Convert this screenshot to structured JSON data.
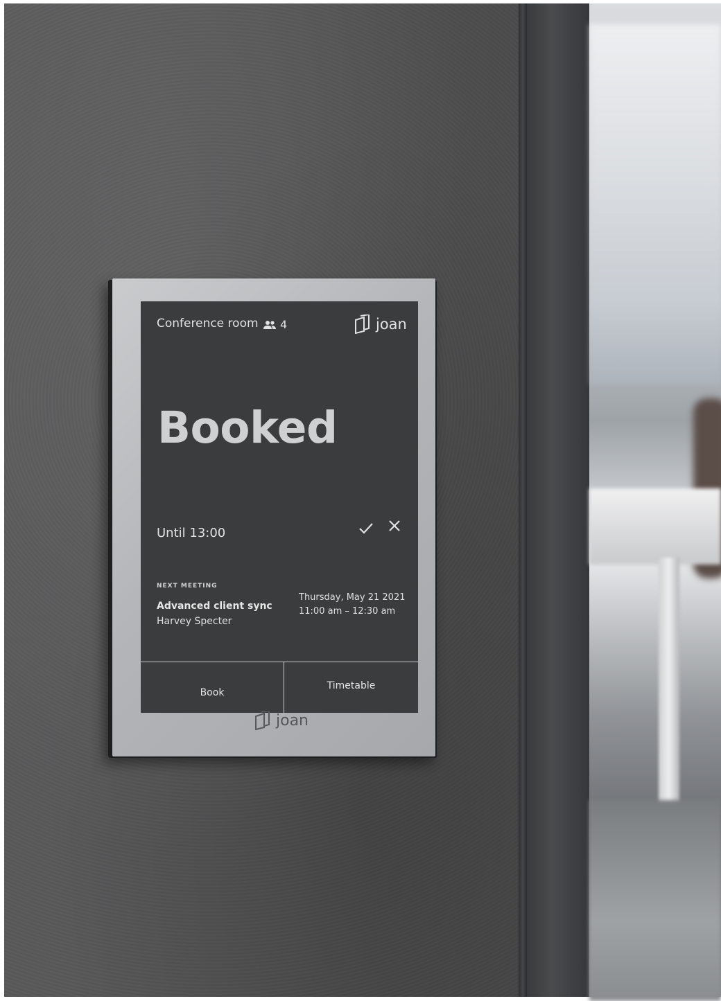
{
  "room": {
    "name": "Conference room",
    "capacity": "4"
  },
  "brand": {
    "screen_logo_text": "joan",
    "bezel_logo_text": "joan"
  },
  "status": {
    "label": "Booked",
    "until": "Until 13:00"
  },
  "next_meeting": {
    "section_label": "NEXT MEETING",
    "title": "Advanced client sync",
    "organizer": "Harvey Specter",
    "date": "Thursday, May 21 2021",
    "time": "11:00 am – 12:30 am"
  },
  "buttons": {
    "book": "Book",
    "timetable": "Timetable"
  },
  "icons": {
    "capacity": "people-icon",
    "confirm": "check-icon",
    "cancel": "close-icon",
    "logo": "joan-logo-icon"
  },
  "colors": {
    "screen_background": "#3b3c3d",
    "screen_text": "#e2e2e2",
    "device_frame": "#b3b5b8",
    "wall": "#555556"
  }
}
